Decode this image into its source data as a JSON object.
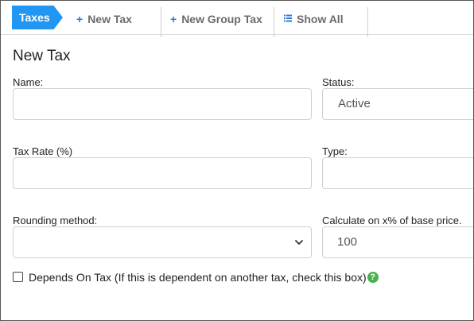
{
  "toolbar": {
    "breadcrumb": "Taxes",
    "new_tax": "New Tax",
    "new_group_tax": "New Group Tax",
    "show_all": "Show All",
    "plus_glyph": "+"
  },
  "form": {
    "title": "New Tax",
    "name_label": "Name:",
    "name_value": "",
    "status_label": "Status:",
    "status_value": "Active",
    "tax_rate_label": "Tax Rate (%)",
    "tax_rate_value": "",
    "type_label": "Type:",
    "type_value": "",
    "rounding_label": "Rounding method:",
    "rounding_value": "",
    "calculate_label": "Calculate on x% of base price.",
    "calculate_value": "100",
    "depends_label": "Depends On Tax (If this is dependent on another tax, check this box)",
    "depends_checked": false,
    "help_glyph": "?"
  },
  "colors": {
    "accent": "#2196f3",
    "icon_blue": "#2a7bd3",
    "help_green": "#4caf50",
    "toolbar_text": "#6b6b6b"
  },
  "icons": [
    "plus-icon",
    "list-icon",
    "chevron-down-icon",
    "help-icon",
    "checkbox-icon"
  ]
}
